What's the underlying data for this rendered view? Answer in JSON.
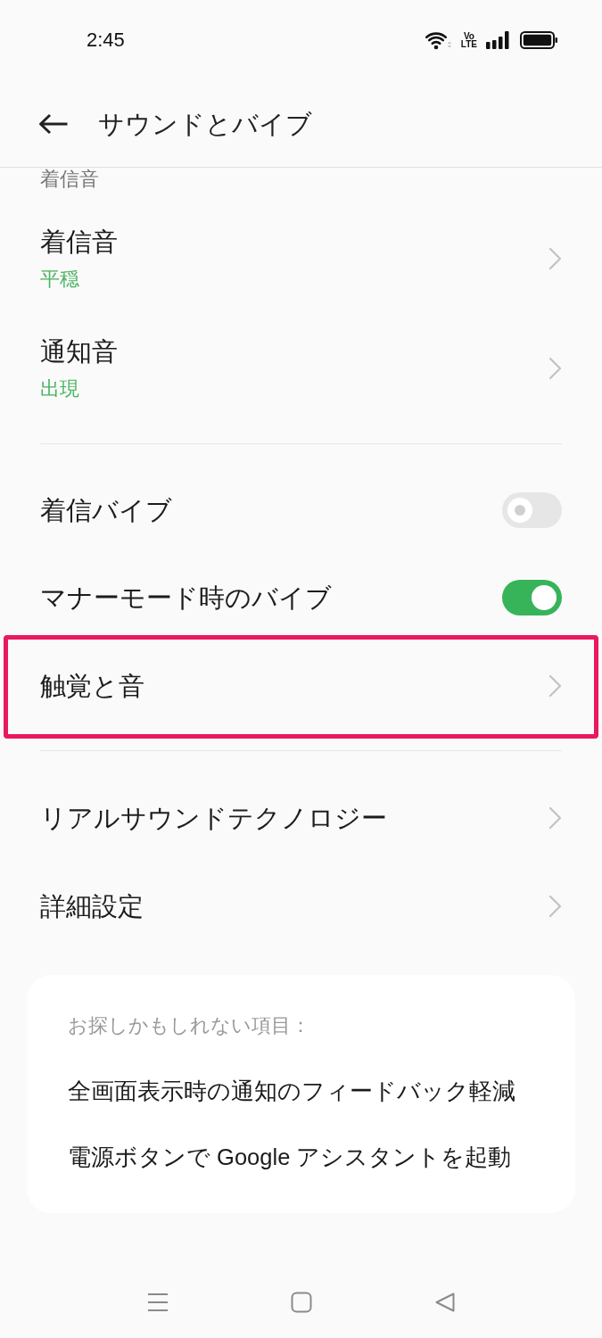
{
  "status_bar": {
    "time": "2:45",
    "network_label": [
      "Vo",
      "LTE"
    ]
  },
  "header": {
    "title": "サウンドとバイブ"
  },
  "groups": [
    {
      "section_label": "着信音",
      "items": [
        {
          "kind": "link",
          "title": "着信音",
          "value": "平穏",
          "highlighted": false
        },
        {
          "kind": "link",
          "title": "通知音",
          "value": "出現",
          "highlighted": false
        }
      ]
    },
    {
      "items": [
        {
          "kind": "toggle",
          "title": "着信バイブ",
          "on": false,
          "highlighted": false
        },
        {
          "kind": "toggle",
          "title": "マナーモード時のバイブ",
          "on": true,
          "highlighted": false
        },
        {
          "kind": "link",
          "title": "触覚と音",
          "highlighted": true
        }
      ]
    },
    {
      "items": [
        {
          "kind": "link",
          "title": "リアルサウンドテクノロジー",
          "highlighted": false
        },
        {
          "kind": "link",
          "title": "詳細設定",
          "highlighted": false
        }
      ]
    }
  ],
  "suggestions": {
    "heading": "お探しかもしれない項目：",
    "items": [
      "全画面表示時の通知のフィードバック軽減",
      "電源ボタンで Google アシスタントを起動"
    ]
  }
}
